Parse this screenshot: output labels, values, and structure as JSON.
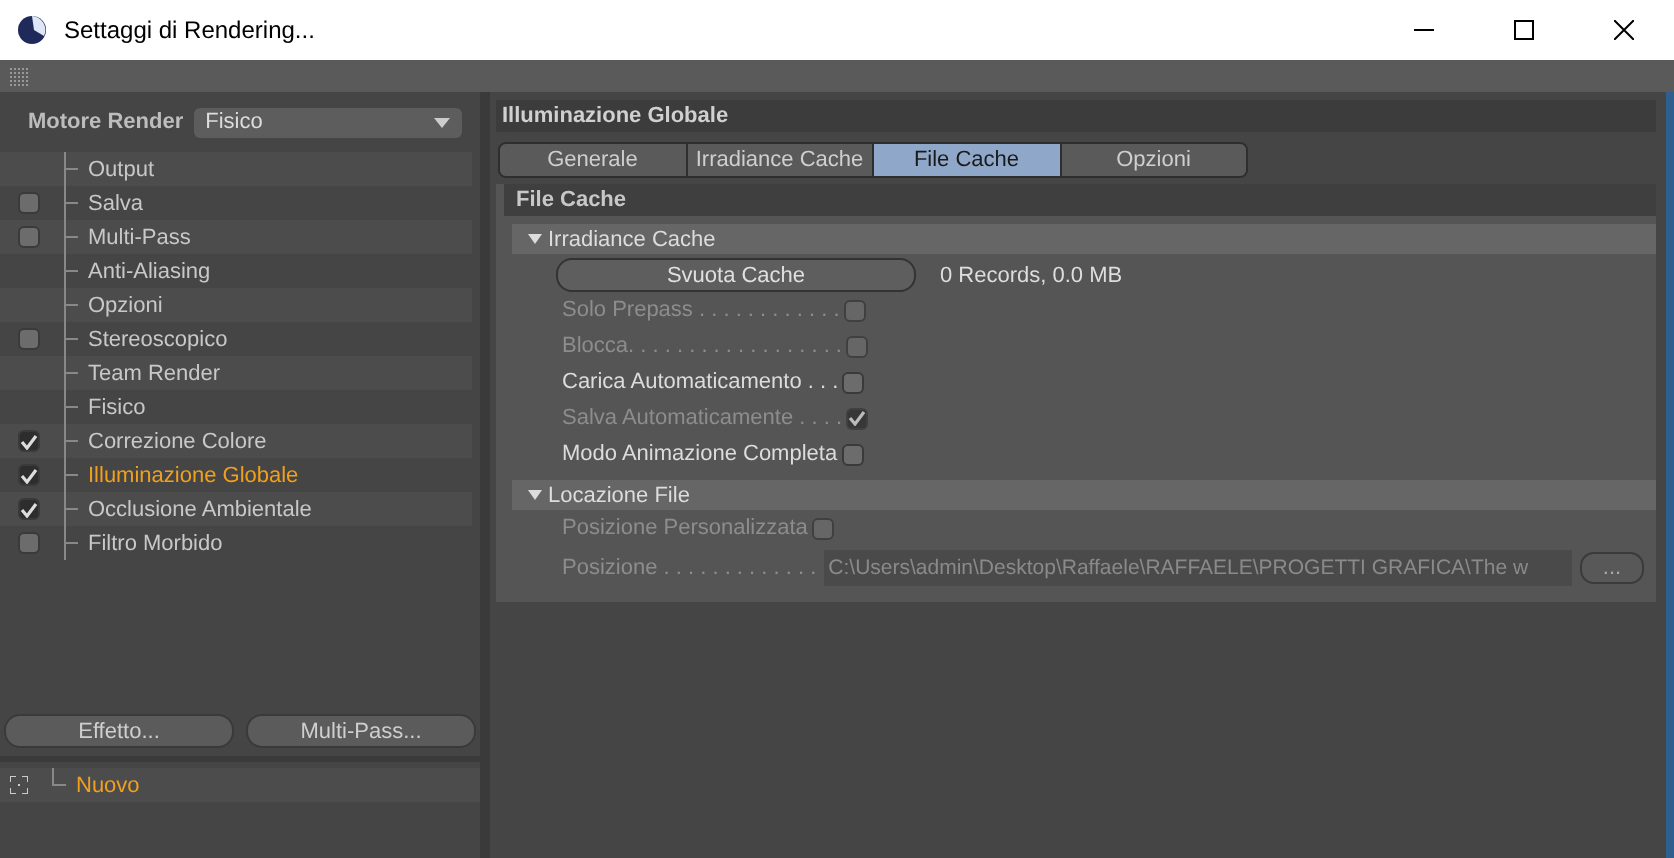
{
  "window": {
    "title": "Settaggi di Rendering..."
  },
  "renderer": {
    "label": "Motore Render",
    "value": "Fisico"
  },
  "sidebar": {
    "items": [
      {
        "label": "Output",
        "kind": "plain",
        "selected": false
      },
      {
        "label": "Salva",
        "kind": "toggle",
        "checked": false,
        "selected": false
      },
      {
        "label": "Multi-Pass",
        "kind": "toggle",
        "checked": false,
        "selected": false
      },
      {
        "label": "Anti-Aliasing",
        "kind": "plain",
        "selected": false
      },
      {
        "label": "Opzioni",
        "kind": "plain",
        "selected": false
      },
      {
        "label": "Stereoscopico",
        "kind": "toggle",
        "checked": false,
        "selected": false
      },
      {
        "label": "Team Render",
        "kind": "plain",
        "selected": false
      },
      {
        "label": "Fisico",
        "kind": "plain",
        "selected": false
      },
      {
        "label": "Correzione Colore",
        "kind": "toggle",
        "checked": true,
        "selected": false
      },
      {
        "label": "Illuminazione Globale",
        "kind": "toggle",
        "checked": true,
        "selected": true
      },
      {
        "label": "Occlusione Ambientale",
        "kind": "toggle",
        "checked": true,
        "selected": false
      },
      {
        "label": "Filtro Morbido",
        "kind": "toggle",
        "checked": false,
        "selected": false
      }
    ]
  },
  "buttons": [
    "Effetto...",
    "Multi-Pass..."
  ],
  "presets": [
    {
      "label": "Nuovo",
      "selected": true
    }
  ],
  "panel": {
    "title": "Illuminazione Globale",
    "tabs": [
      {
        "label": "Generale",
        "selected": false
      },
      {
        "label": "Irradiance Cache",
        "selected": false
      },
      {
        "label": "File Cache",
        "selected": true
      },
      {
        "label": "Opzioni",
        "selected": false
      }
    ],
    "group_title": "File Cache",
    "sections": [
      {
        "title": "Irradiance Cache",
        "expanded": true,
        "button": "Svuota Cache",
        "info": "0 Records, 0.0 MB",
        "options": [
          {
            "label": "Solo Prepass . . . . . . . . . . . .",
            "disabled": true,
            "checked": false
          },
          {
            "label": "Blocca. . . . . . . . . . . . . . . . . .",
            "disabled": true,
            "checked": false
          },
          {
            "label": "Carica Automaticamento . . .",
            "disabled": false,
            "checked": false
          },
          {
            "label": "Salva Automaticamente . . . .",
            "disabled": true,
            "checked": true
          },
          {
            "label": "Modo Animazione Completa",
            "disabled": false,
            "checked": false
          }
        ]
      },
      {
        "title": "Locazione File",
        "expanded": true,
        "options": [
          {
            "label": "Posizione Personalizzata",
            "disabled": true,
            "checked": false
          }
        ],
        "path": {
          "label": "Posizione . . . . . . . . . . . . .",
          "value": "C:\\Users\\admin\\Desktop\\Raffaele\\RAFFAELE\\PROGETTI GRAFICA\\The w",
          "disabled": true,
          "browse": "..."
        }
      }
    ]
  }
}
